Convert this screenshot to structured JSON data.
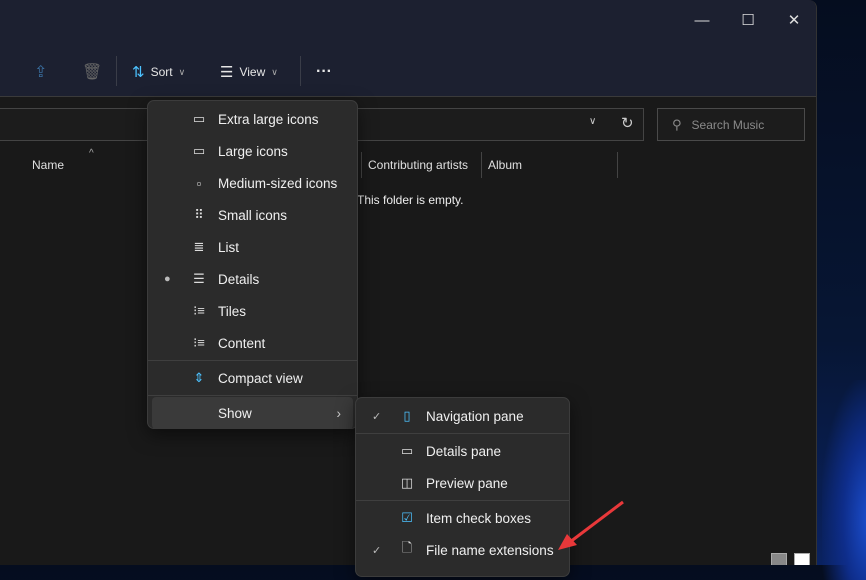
{
  "toolbar": {
    "sort": "Sort",
    "view": "View",
    "more": "···"
  },
  "window_controls": {
    "minimize": "—",
    "maximize": "☐",
    "close": "✕"
  },
  "search": {
    "placeholder": "Search Music"
  },
  "columns": [
    "Name",
    "Contributing artists",
    "Album"
  ],
  "empty_message": "This folder is empty.",
  "view_menu": {
    "items": [
      {
        "label": "Extra large icons",
        "icon": "monitor-icon",
        "selected": false
      },
      {
        "label": "Large icons",
        "icon": "monitor-icon",
        "selected": false
      },
      {
        "label": "Medium-sized icons",
        "icon": "monitor-icon",
        "selected": false
      },
      {
        "label": "Small icons",
        "icon": "grid-icon",
        "selected": false
      },
      {
        "label": "List",
        "icon": "list-icon",
        "selected": false
      },
      {
        "label": "Details",
        "icon": "details-icon",
        "selected": true
      },
      {
        "label": "Tiles",
        "icon": "tiles-icon",
        "selected": false
      },
      {
        "label": "Content",
        "icon": "content-icon",
        "selected": false
      }
    ],
    "compact": "Compact view",
    "show": "Show"
  },
  "show_menu": {
    "items": [
      {
        "label": "Navigation pane",
        "checked": true
      },
      {
        "label": "Details pane",
        "checked": false
      },
      {
        "label": "Preview pane",
        "checked": false
      },
      {
        "label": "Item check boxes",
        "checked": false
      },
      {
        "label": "File name extensions",
        "checked": true
      }
    ]
  },
  "accent": "#4cc2ff",
  "arrow_color": "#e8383a"
}
